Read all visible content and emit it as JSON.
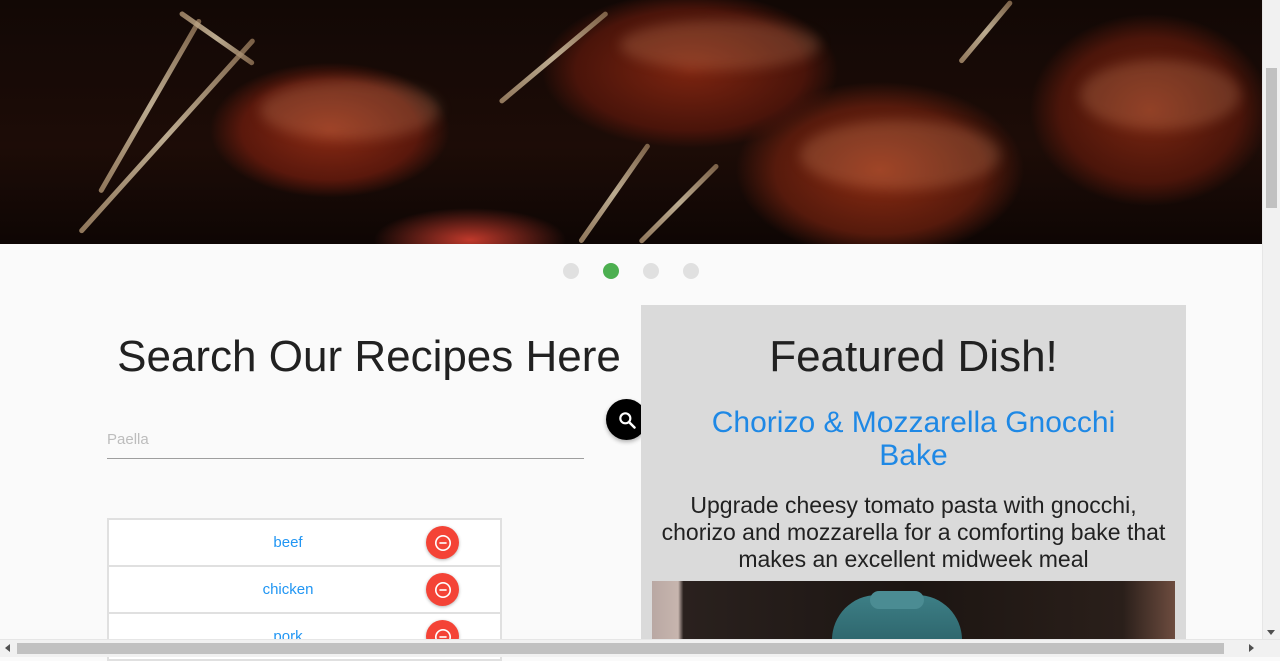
{
  "carousel": {
    "slides": [
      {
        "name": "slide-1",
        "active": false
      },
      {
        "name": "slide-2",
        "active": true
      },
      {
        "name": "slide-3",
        "active": false
      },
      {
        "name": "slide-4",
        "active": false
      }
    ],
    "active_color": "#4caf50",
    "inactive_color": "#e0e0e0"
  },
  "search": {
    "title": "Search Our Recipes Here",
    "placeholder": "Paella",
    "value": "",
    "button_icon": "search-icon"
  },
  "ingredients": {
    "items": [
      {
        "label": "beef",
        "remove_icon": "minus-circle-icon"
      },
      {
        "label": "chicken",
        "remove_icon": "minus-circle-icon"
      },
      {
        "label": "pork",
        "remove_icon": "minus-circle-icon"
      }
    ],
    "label_color": "#2196f3",
    "remove_color": "#f44336"
  },
  "featured": {
    "heading": "Featured Dish!",
    "dish_name": "Chorizo & Mozzarella Gnocchi Bake",
    "description": "Upgrade cheesy tomato pasta with gnocchi, chorizo and mozzarella for a comforting bake that makes an excellent midweek meal",
    "link_color": "#1e88e5",
    "background": "#dadada"
  }
}
